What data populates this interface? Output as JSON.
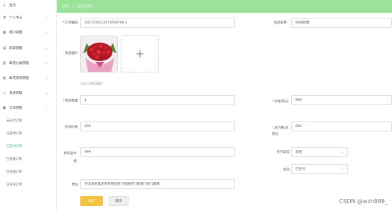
{
  "sidebar": {
    "items": [
      {
        "label": "首页",
        "icon": "home-icon"
      },
      {
        "label": "个人中心",
        "icon": "user-icon"
      },
      {
        "label": "用户管理",
        "icon": "users-icon"
      },
      {
        "label": "商家管理",
        "icon": "store-icon"
      },
      {
        "label": "鲜花分类管理",
        "icon": "grid-icon"
      },
      {
        "label": "鲜花资讯管理",
        "icon": "news-icon"
      },
      {
        "label": "系统管理",
        "icon": "settings-icon"
      },
      {
        "label": "订单管理",
        "icon": "orders-icon"
      }
    ],
    "sub_items": [
      "未支付订单",
      "已取消订单",
      "已支付订单",
      "已退款订单",
      "已完成订单",
      "已发货订单"
    ],
    "active_sub": "已支付订单"
  },
  "topbar": {
    "home": "首页",
    "sep": "››",
    "current": "已支付订单"
  },
  "form": {
    "order_no_label": "订单编号",
    "order_no_value": "2021510112071609706 4",
    "product_name_label": "商品名称",
    "product_name_value": "99朵玫瑰",
    "product_image_label": "商品图片",
    "upload_hint": "点击上传商品图片",
    "quantity_label": "购买数量",
    "quantity_value": "1",
    "price_label": "价格/积分",
    "price_value": "999",
    "discount_price_label": "折扣价格",
    "discount_price_value": "999",
    "total_price_label": "总价格/总积分",
    "total_price_value": "999",
    "discount_total_label": "折扣总价格",
    "discount_total_value": "999",
    "pay_type_label": "支付类型",
    "pay_type_value": "现金",
    "status_label": "状态",
    "status_value": "已支付",
    "address_label": "地址",
    "address_value": "河北省石家庄市桥西区纺门街道纺门街道门纺门路路"
  },
  "buttons": {
    "submit": "提交",
    "cancel": "取消"
  },
  "watermark": "CSDN @wzh888_",
  "colors": {
    "accent": "#9be29a",
    "active": "#3cb371",
    "submit": "#f6c140",
    "required": "#e33333"
  }
}
